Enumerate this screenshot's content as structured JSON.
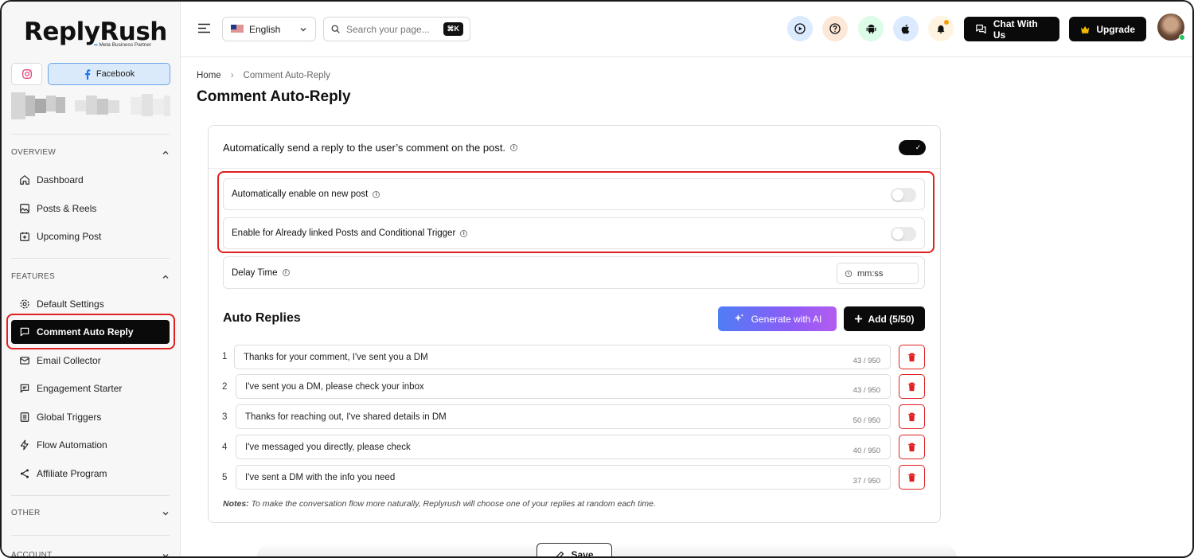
{
  "brand": {
    "name": "ReplyRush",
    "subtitle": "Meta Business Partner"
  },
  "accounts": {
    "facebook_label": "Facebook"
  },
  "sidebar": {
    "overview_heading": "OVERVIEW",
    "overview_items": [
      {
        "label": "Dashboard",
        "icon": "home-icon"
      },
      {
        "label": "Posts & Reels",
        "icon": "image-icon"
      },
      {
        "label": "Upcoming Post",
        "icon": "calendar-plus-icon"
      }
    ],
    "features_heading": "FEATURES",
    "feature_items": [
      {
        "label": "Default Settings",
        "icon": "gear-icon"
      },
      {
        "label": "Comment Auto Reply",
        "icon": "comment-icon",
        "active": true
      },
      {
        "label": "Email Collector",
        "icon": "mail-icon"
      },
      {
        "label": "Engagement Starter",
        "icon": "chat-icon"
      },
      {
        "label": "Global Triggers",
        "icon": "list-icon"
      },
      {
        "label": "Flow Automation",
        "icon": "bolt-icon"
      },
      {
        "label": "Affiliate Program",
        "icon": "share-icon"
      }
    ],
    "other_heading": "OTHER",
    "account_heading": "ACCOUNT"
  },
  "topbar": {
    "language": "English",
    "search_placeholder": "Search your page...",
    "search_shortcut": "⌘K",
    "chat_label": "Chat With Us",
    "upgrade_label": "Upgrade"
  },
  "breadcrumb": {
    "home": "Home",
    "current": "Comment Auto-Reply"
  },
  "page_title": "Comment Auto-Reply",
  "settings": {
    "main_toggle_label": "Automatically send a reply to the user’s comment on the post.",
    "main_toggle_on": true,
    "auto_enable_label": "Automatically enable on new post",
    "auto_enable_on": false,
    "linked_posts_label": "Enable for Already linked Posts and Conditional Trigger",
    "linked_posts_on": false,
    "delay_label": "Delay Time",
    "delay_placeholder": "mm:ss"
  },
  "auto_replies": {
    "title": "Auto Replies",
    "generate_label": "Generate with AI",
    "add_label": "Add (5/50)",
    "items": [
      {
        "num": "1",
        "text": "Thanks for your comment, I've sent you a DM",
        "count": "43 / 950"
      },
      {
        "num": "2",
        "text": "I've sent you a DM, please check your inbox",
        "count": "43 / 950"
      },
      {
        "num": "3",
        "text": "Thanks for reaching out, I've shared details in DM",
        "count": "50 / 950"
      },
      {
        "num": "4",
        "text": "I've messaged you directly, please check",
        "count": "40 / 950"
      },
      {
        "num": "5",
        "text": "I've sent a DM with the info you need",
        "count": "37 / 950"
      }
    ],
    "notes_label": "Notes:",
    "notes_text": " To make the conversation flow more naturally, Replyrush will choose one of your replies at random each time."
  },
  "save_label": "Save",
  "colors": {
    "accent": "#0a0a0a",
    "highlight": "#e02020",
    "ai_gradient_start": "#4f7df5",
    "ai_gradient_end": "#b35cf0",
    "delete": "#e02020"
  }
}
